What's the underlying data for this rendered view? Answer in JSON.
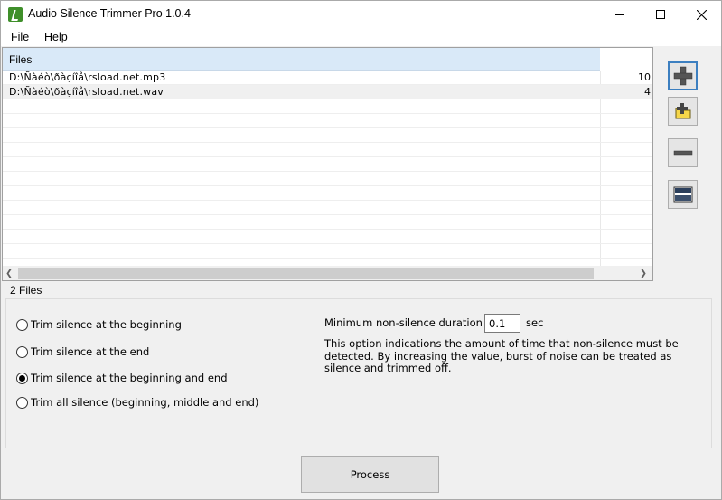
{
  "window": {
    "title": "Audio Silence Trimmer Pro 1.0.4"
  },
  "menu": {
    "file": "File",
    "help": "Help"
  },
  "filelist": {
    "header": "Files",
    "rows": [
      {
        "path": "D:\\Ñàéò\\ðàçíîå\\rsload.net.mp3",
        "size": "10"
      },
      {
        "path": "D:\\Ñàéò\\ðàçíîå\\rsload.net.wav",
        "size": "4"
      }
    ]
  },
  "status": {
    "file_count": "2 Files"
  },
  "side_toolbar": {
    "icons": [
      "add-file-icon",
      "add-folder-icon",
      "remove-icon",
      "clear-list-icon"
    ]
  },
  "options": {
    "trim_modes": [
      {
        "label": "Trim silence at the beginning",
        "checked": false
      },
      {
        "label": "Trim silence at the end",
        "checked": false
      },
      {
        "label": "Trim silence at the beginning and end",
        "checked": true
      },
      {
        "label": "Trim all silence (beginning, middle and end)",
        "checked": false
      }
    ],
    "min_duration_label": "Minimum non-silence duration",
    "min_duration_value": "0.1",
    "min_duration_unit": "sec",
    "description": "This option indications the amount of time that non-silence must be detected. By increasing the value, burst of noise can be treated as silence and trimmed off."
  },
  "actions": {
    "process": "Process"
  },
  "colors": {
    "header_bg": "#d9e9f8",
    "focus_border": "#3c7fc0",
    "app_icon": "#3f8f2a"
  }
}
